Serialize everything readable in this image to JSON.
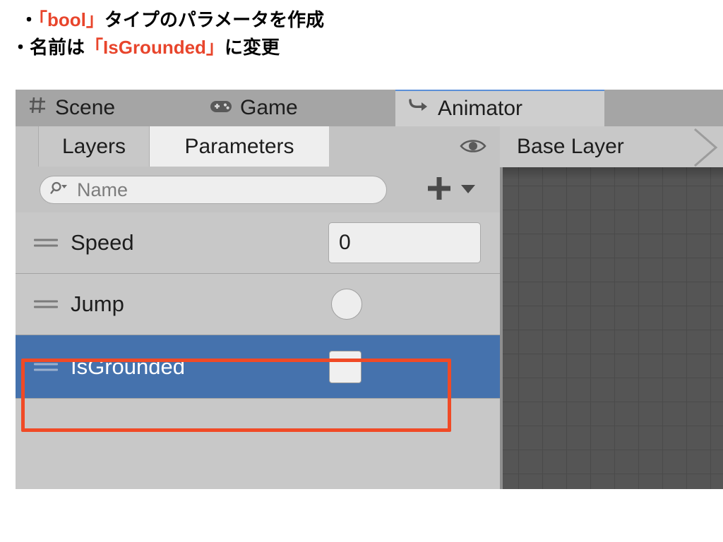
{
  "caption": {
    "line1_bullet": "・",
    "line1_part1": "「bool」",
    "line1_part2": "タイプのパラメータを作成",
    "line2_bullet": "・",
    "line2_part1": "名前は",
    "line2_part2": "「IsGrounded」",
    "line2_part3": "に変更",
    "accent_color": "#e8452c"
  },
  "window": {
    "tabs": [
      {
        "label": "Scene",
        "icon": "grid-icon",
        "active": false
      },
      {
        "label": "Game",
        "icon": "gamepad-icon",
        "active": false
      },
      {
        "label": "Animator",
        "icon": "transition-arrow-icon",
        "active": true
      }
    ],
    "toolbar": {
      "subtabs": [
        {
          "label": "Layers",
          "active": false
        },
        {
          "label": "Parameters",
          "active": true
        }
      ],
      "eye_icon": "eye-icon",
      "breadcrumb": "Base Layer",
      "breadcrumb_chevron": "chevron-right-icon"
    },
    "search": {
      "placeholder": "Name",
      "value": "",
      "icon": "search-icon",
      "add_button": "+",
      "add_dropdown": "▼"
    },
    "parameters": [
      {
        "name": "Speed",
        "type": "float",
        "value": "0",
        "selected": false,
        "handle_icon": "drag-handle-icon"
      },
      {
        "name": "Jump",
        "type": "trigger",
        "value": "",
        "selected": false,
        "handle_icon": "drag-handle-icon"
      },
      {
        "name": "IsGrounded",
        "type": "bool",
        "value": "false",
        "selected": true,
        "handle_icon": "drag-handle-icon"
      }
    ],
    "colors": {
      "selection_blue": "#4572ad",
      "panel_gray": "#c8c8c8",
      "tabstrip_gray": "#a5a5a5",
      "canvas_gray": "#555555",
      "annotation_red": "#f04a26"
    }
  }
}
